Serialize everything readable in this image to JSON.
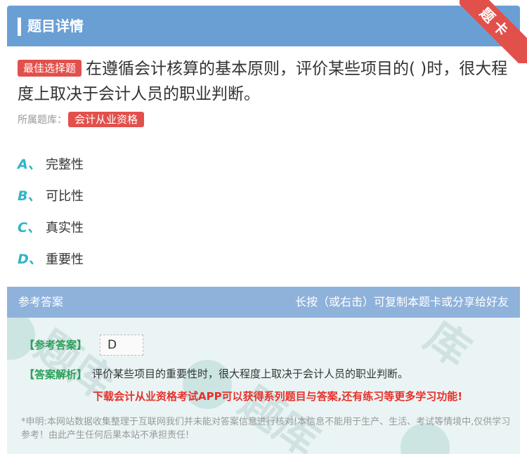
{
  "header": {
    "title": "题目详情"
  },
  "corner": {
    "label": "题卡"
  },
  "question": {
    "tag": "最佳选择题",
    "text": "在遵循会计核算的基本原则，评价某些项目的( )时，很大程度上取决于会计人员的职业判断。"
  },
  "bank": {
    "label": "所属题库：",
    "value": "会计从业资格"
  },
  "options": [
    {
      "letter": "A、",
      "text": "完整性"
    },
    {
      "letter": "B、",
      "text": "可比性"
    },
    {
      "letter": "C、",
      "text": "真实性"
    },
    {
      "letter": "D、",
      "text": "重要性"
    }
  ],
  "answer": {
    "head_left": "参考答案",
    "head_right": "长按（或右击）可复制本题卡或分享给好友",
    "ref_label": "【参考答案】",
    "ref_value": "D",
    "analysis_label": "【答案解析】",
    "analysis_text": "评价某些项目的重要性时，很大程度上取决于会计人员的职业判断。",
    "promo": "下载会计从业资格考试APP可以获得系列题目与答案,还有练习等更多学习功能!",
    "disclaimer": "*申明:本网站数据收集整理于互联网我们并未能对答案信息进行核对!本信息不能用于生产、生活、考试等情境中,仅供学习参考！由此产生任何后果本站不承担责任!"
  },
  "colors": {
    "header": "#6a9fd4",
    "accent_red": "#e2504c",
    "option_letter": "#2eb5c6",
    "answer_green": "#2aa05a"
  }
}
